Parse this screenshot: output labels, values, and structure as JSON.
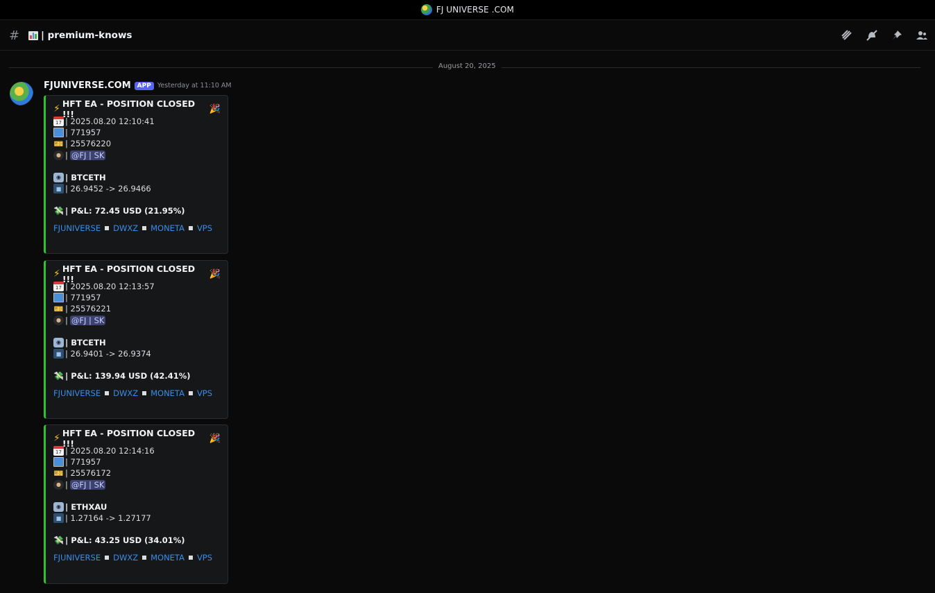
{
  "window": {
    "title": "FJ UNIVERSE .COM"
  },
  "channel": {
    "name": "premium-knows",
    "separator": "|"
  },
  "date_divider": "August 20, 2025",
  "message": {
    "author": "FJUNIVERSE.COM",
    "badge": "APP",
    "timestamp": "Yesterday at 11:10 AM"
  },
  "embeds": [
    {
      "title": "HFT EA - POSITION CLOSED !!!",
      "datetime": "| 2025.08.20 12:10:41",
      "account": "| 771957",
      "ticket": "| 25576220",
      "mention": "@FJ | SK",
      "symbol": "| BTCETH",
      "prices": "| 26.9452 -> 26.9466",
      "pnl": "| P&L: 72.45 USD (21.95%)"
    },
    {
      "title": "HFT EA - POSITION CLOSED !!!",
      "datetime": "| 2025.08.20 12:13:57",
      "account": "| 771957",
      "ticket": "| 25576221",
      "mention": "@FJ | SK",
      "symbol": "| BTCETH",
      "prices": "| 26.9401 -> 26.9374",
      "pnl": "| P&L: 139.94 USD (42.41%)"
    },
    {
      "title": "HFT EA - POSITION CLOSED !!!",
      "datetime": "| 2025.08.20 12:14:16",
      "account": "| 771957",
      "ticket": "| 25576172",
      "mention": "@FJ | SK",
      "symbol": "| ETHXAU",
      "prices": "| 1.27164 -> 1.27177",
      "pnl": "| P&L: 43.25 USD (34.01%)"
    }
  ],
  "links": [
    "FJUNIVERSE",
    "DWXZ",
    "MONETA",
    "VPS"
  ],
  "colors": {
    "accent_bar": "#2dc42d",
    "link": "#3b8de8",
    "badge": "#5865f2"
  },
  "icons": [
    "threads-icon",
    "notification-muted-icon",
    "pin-icon",
    "members-icon"
  ]
}
